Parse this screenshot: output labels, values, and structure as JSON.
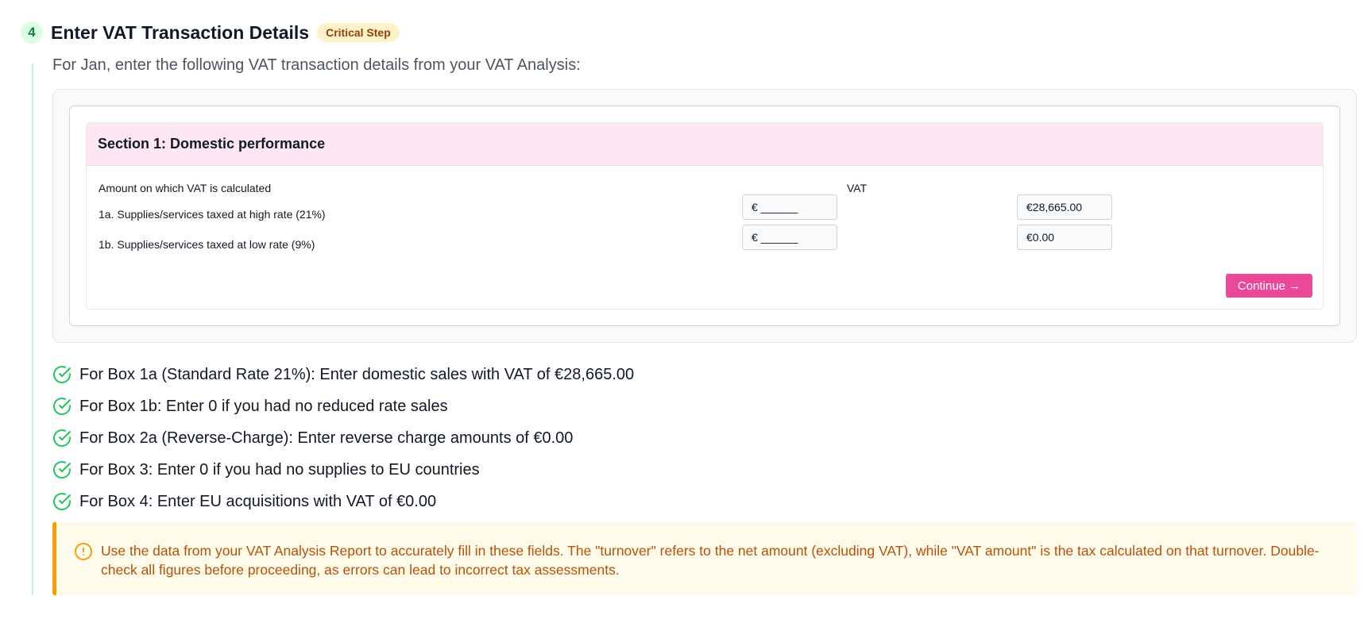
{
  "step": {
    "number": "4",
    "title": "Enter VAT Transaction Details",
    "badge": "Critical Step",
    "intro": "For Jan, enter the following VAT transaction details from your VAT Analysis:"
  },
  "form": {
    "section_title": "Section 1: Domestic performance",
    "col_amount_label": "Amount on which VAT is calculated",
    "col_vat_label": "VAT",
    "rows": [
      {
        "label": "1a. Supplies/services taxed at high rate (21%)",
        "amount_value": "€ ______",
        "vat_value": "€28,665.00"
      },
      {
        "label": "1b. Supplies/services taxed at low rate (9%)",
        "amount_value": "€ ______",
        "vat_value": "€0.00"
      }
    ],
    "continue_label": "Continue →"
  },
  "checklist": [
    "For Box 1a (Standard Rate 21%): Enter domestic sales with VAT of €28,665.00",
    "For Box 1b: Enter 0 if you had no reduced rate sales",
    "For Box 2a (Reverse-Charge): Enter reverse charge amounts of €0.00",
    "For Box 3: Enter 0 if you had no supplies to EU countries",
    "For Box 4: Enter EU acquisitions with VAT of €0.00"
  ],
  "note": {
    "icon": "alert-circle-icon",
    "text": "Use the data from your VAT Analysis Report to accurately fill in these fields. The \"turnover\" refers to the net amount (excluding VAT), while \"VAT amount\" is the tax calculated on that turnover. Double-check all figures before proceeding, as errors can lead to incorrect tax assessments."
  },
  "colors": {
    "accent_pink": "#ec4899",
    "section_header_bg": "#fce7f3",
    "success_green": "#22c55e",
    "warning_amber": "#f59e0b",
    "warning_text": "#b45309"
  }
}
